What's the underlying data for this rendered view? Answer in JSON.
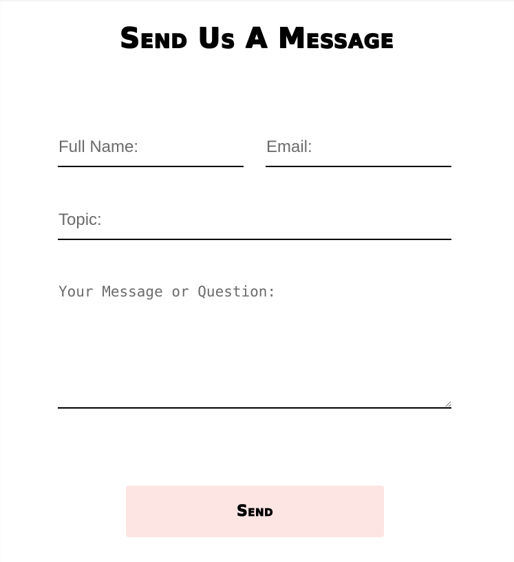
{
  "form": {
    "title": "Send Us A Message",
    "full_name": {
      "placeholder": "Full Name:",
      "value": ""
    },
    "email": {
      "placeholder": "Email:",
      "value": ""
    },
    "topic": {
      "placeholder": "Topic:",
      "value": ""
    },
    "message": {
      "placeholder": "Your Message or Question:",
      "value": ""
    },
    "send_label": "Send"
  },
  "colors": {
    "button_background": "#fde5e4",
    "field_underline": "#000000",
    "placeholder_text": "#6b6b6b"
  }
}
